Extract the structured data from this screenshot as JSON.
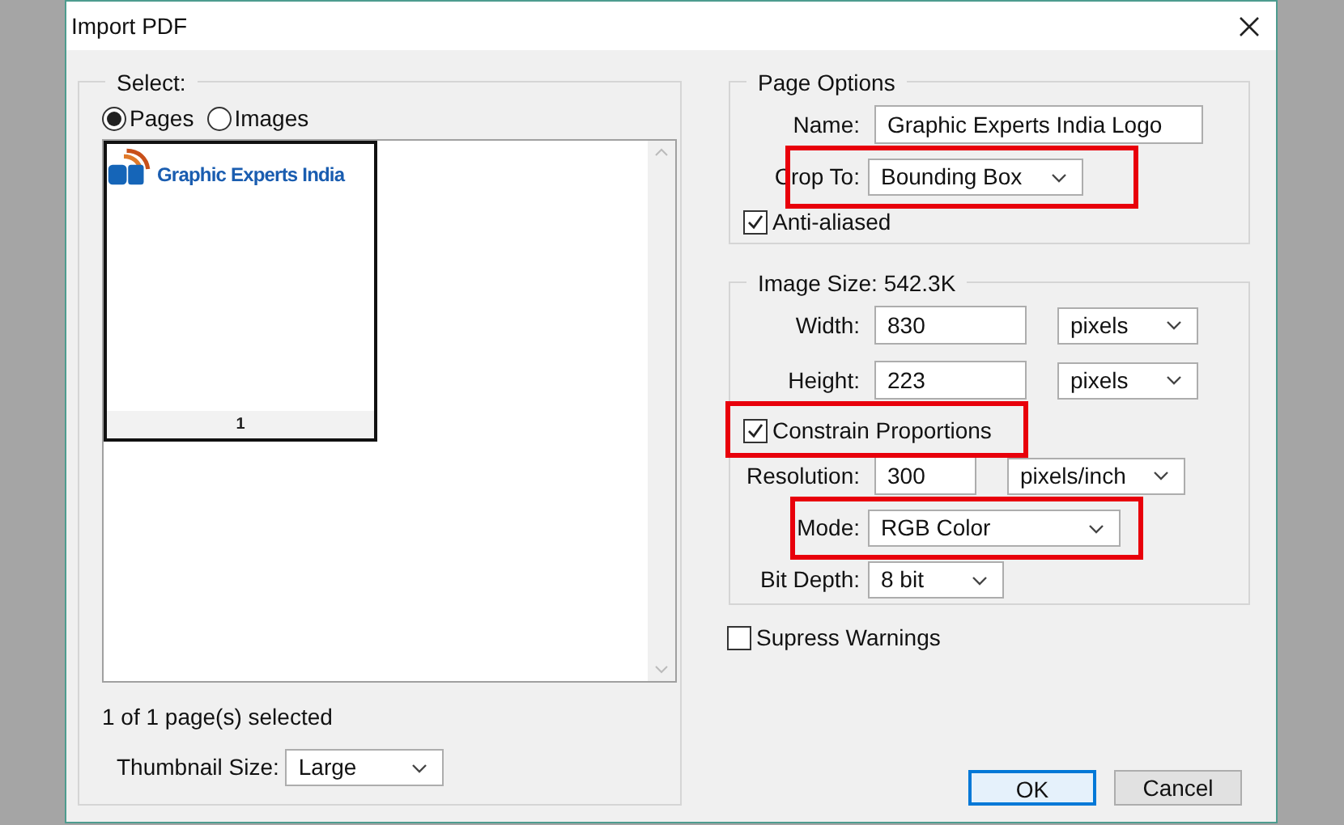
{
  "window": {
    "title": "Import PDF"
  },
  "select": {
    "legend": "Select:",
    "modes": [
      {
        "label": "Pages",
        "selected": true
      },
      {
        "label": "Images",
        "selected": false
      }
    ],
    "thumbnails": [
      {
        "text": "Graphic Experts India",
        "number": "1",
        "selected": true
      }
    ],
    "status": "1 of 1 page(s) selected",
    "thumbnail_size": {
      "label": "Thumbnail Size:",
      "value": "Large"
    }
  },
  "page_options": {
    "legend": "Page Options",
    "name": {
      "label": "Name:",
      "value": "Graphic Experts India Logo"
    },
    "crop_to": {
      "label": "Crop To:",
      "value": "Bounding Box",
      "highlighted": true
    },
    "anti_aliased": {
      "label": "Anti-aliased",
      "checked": true
    }
  },
  "image_size": {
    "legend": "Image Size: 542.3K",
    "width": {
      "label": "Width:",
      "value": "830",
      "unit": "pixels"
    },
    "height": {
      "label": "Height:",
      "value": "223",
      "unit": "pixels"
    },
    "constrain": {
      "label": "Constrain Proportions",
      "checked": true,
      "highlighted": true
    },
    "resolution": {
      "label": "Resolution:",
      "value": "300",
      "unit": "pixels/inch"
    },
    "mode": {
      "label": "Mode:",
      "value": "RGB Color",
      "highlighted": true
    },
    "bit_depth": {
      "label": "Bit Depth:",
      "value": "8 bit"
    }
  },
  "suppress_warnings": {
    "label": "Supress Warnings",
    "checked": false
  },
  "buttons": [
    {
      "label": "OK",
      "kind": "default"
    },
    {
      "label": "Cancel",
      "kind": "normal"
    }
  ]
}
